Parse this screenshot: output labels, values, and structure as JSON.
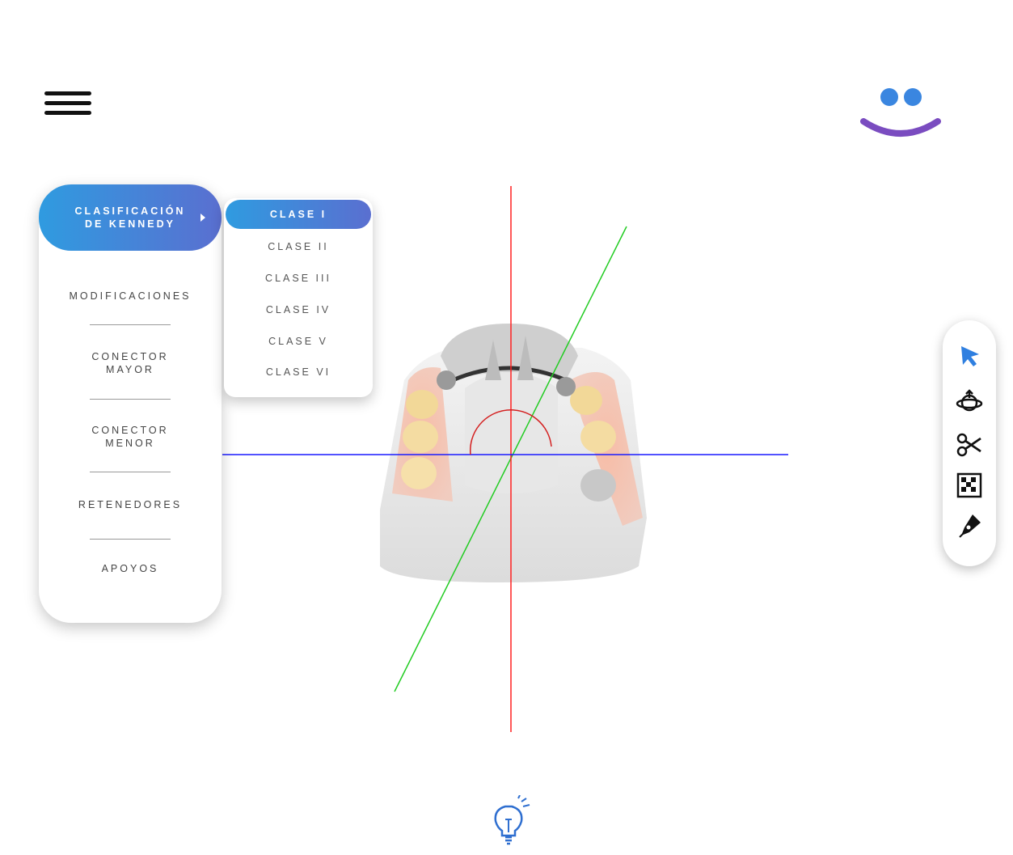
{
  "menu": {
    "active_label": "CLASIFICACIÓN\nDE KENNEDY",
    "items": [
      {
        "label": "MODIFICACIONES"
      },
      {
        "label": "CONECTOR\nMAYOR"
      },
      {
        "label": "CONECTOR\nMENOR"
      },
      {
        "label": "RETENEDORES"
      },
      {
        "label": "APOYOS"
      }
    ]
  },
  "submenu": {
    "active_label": "CLASE I",
    "items": [
      {
        "label": "CLASE II"
      },
      {
        "label": "CLASE III"
      },
      {
        "label": "CLASE IV"
      },
      {
        "label": "CLASE V"
      },
      {
        "label": "CLASE VI"
      }
    ]
  },
  "toolbar": {
    "tools": [
      {
        "icon": "cursor-arrow-icon",
        "active": true
      },
      {
        "icon": "rotate-orbit-icon"
      },
      {
        "icon": "scissors-icon"
      },
      {
        "icon": "checker-texture-icon"
      },
      {
        "icon": "pen-icon"
      }
    ]
  },
  "colors": {
    "accent_start": "#2f9be0",
    "accent_end": "#5a6fd0",
    "axis_x": "#1a1aff",
    "axis_y": "#ff2020",
    "axis_z": "#22cc22",
    "logo_eyes": "#3a86e0",
    "logo_smile": "#7a4cc0"
  }
}
